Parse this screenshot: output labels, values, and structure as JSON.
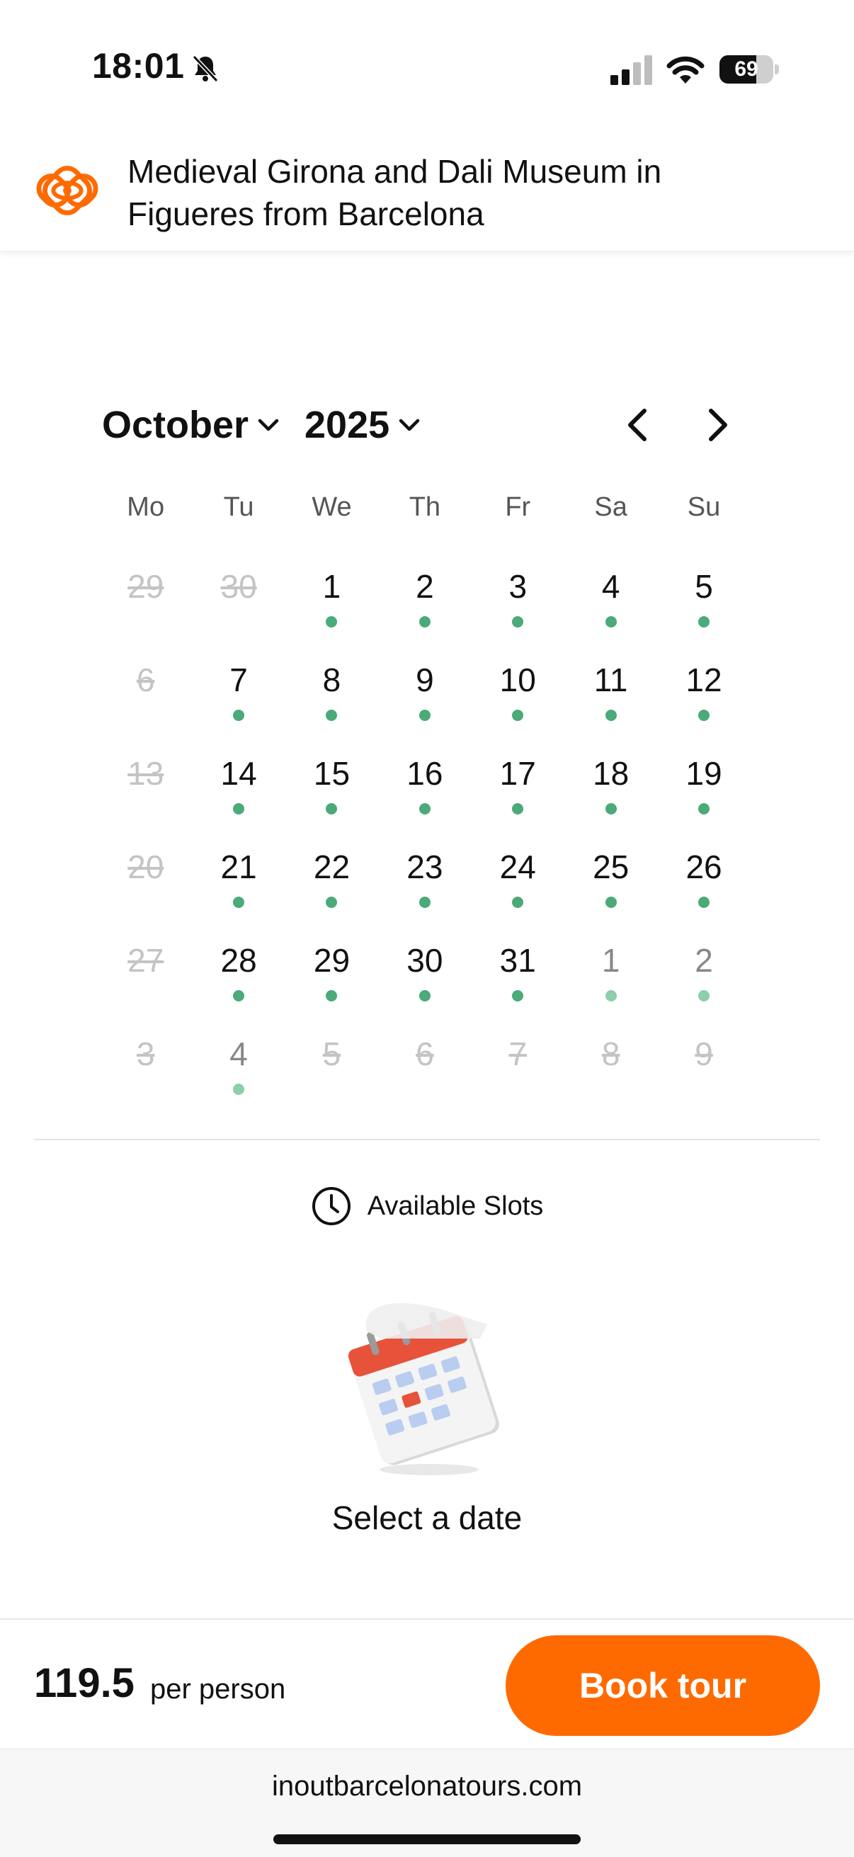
{
  "status": {
    "time": "18:01",
    "battery_percent": "69",
    "battery_level": 0.69,
    "icons": [
      "bell-slash-icon",
      "signal-icon",
      "wifi-icon",
      "battery-icon"
    ]
  },
  "header": {
    "title": "Medieval Girona and Dali Museum in Figueres from Barcelona",
    "logo_color": "#ff6a00"
  },
  "calendar": {
    "month": "October",
    "year": "2025",
    "weekdays": [
      "Mo",
      "Tu",
      "We",
      "Th",
      "Fr",
      "Sa",
      "Su"
    ],
    "days": [
      {
        "n": "29",
        "state": "strike"
      },
      {
        "n": "30",
        "state": "strike"
      },
      {
        "n": "1",
        "state": "avail"
      },
      {
        "n": "2",
        "state": "avail"
      },
      {
        "n": "3",
        "state": "avail"
      },
      {
        "n": "4",
        "state": "avail"
      },
      {
        "n": "5",
        "state": "avail"
      },
      {
        "n": "6",
        "state": "strike"
      },
      {
        "n": "7",
        "state": "avail"
      },
      {
        "n": "8",
        "state": "avail"
      },
      {
        "n": "9",
        "state": "avail"
      },
      {
        "n": "10",
        "state": "avail"
      },
      {
        "n": "11",
        "state": "avail"
      },
      {
        "n": "12",
        "state": "avail"
      },
      {
        "n": "13",
        "state": "strike"
      },
      {
        "n": "14",
        "state": "avail"
      },
      {
        "n": "15",
        "state": "avail"
      },
      {
        "n": "16",
        "state": "avail"
      },
      {
        "n": "17",
        "state": "avail"
      },
      {
        "n": "18",
        "state": "avail"
      },
      {
        "n": "19",
        "state": "avail"
      },
      {
        "n": "20",
        "state": "strike"
      },
      {
        "n": "21",
        "state": "avail"
      },
      {
        "n": "22",
        "state": "avail"
      },
      {
        "n": "23",
        "state": "avail"
      },
      {
        "n": "24",
        "state": "avail"
      },
      {
        "n": "25",
        "state": "avail"
      },
      {
        "n": "26",
        "state": "avail"
      },
      {
        "n": "27",
        "state": "strike"
      },
      {
        "n": "28",
        "state": "avail"
      },
      {
        "n": "29",
        "state": "avail"
      },
      {
        "n": "30",
        "state": "avail"
      },
      {
        "n": "31",
        "state": "avail"
      },
      {
        "n": "1",
        "state": "other-avail"
      },
      {
        "n": "2",
        "state": "other-avail"
      },
      {
        "n": "3",
        "state": "strike"
      },
      {
        "n": "4",
        "state": "other-avail"
      },
      {
        "n": "5",
        "state": "strike"
      },
      {
        "n": "6",
        "state": "strike"
      },
      {
        "n": "7",
        "state": "strike"
      },
      {
        "n": "8",
        "state": "strike"
      },
      {
        "n": "9",
        "state": "strike"
      }
    ],
    "available_color": "#4aaa78"
  },
  "slots": {
    "label": "Available Slots",
    "empty_text": "Select a date"
  },
  "footer": {
    "price": "119.5",
    "per": "per person",
    "book_label": "Book tour",
    "accent": "#ff6a00"
  },
  "browser": {
    "url": "inoutbarcelonatours.com"
  }
}
